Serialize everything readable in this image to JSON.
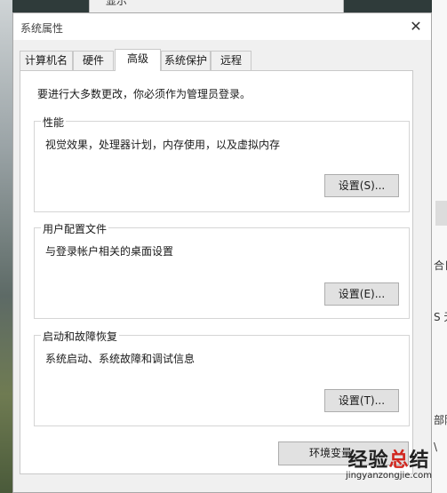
{
  "background": {
    "top_window_peek": "显示",
    "right_fragments": [
      "合日",
      "S 无",
      "部附",
      "\\"
    ]
  },
  "dialog": {
    "title": "系统属性",
    "close_glyph": "✕",
    "tabs": [
      {
        "label": "计算机名",
        "active": false
      },
      {
        "label": "硬件",
        "active": false
      },
      {
        "label": "高级",
        "active": true
      },
      {
        "label": "系统保护",
        "active": false
      },
      {
        "label": "远程",
        "active": false
      }
    ],
    "notice": "要进行大多数更改，你必须作为管理员登录。",
    "groups": [
      {
        "legend": "性能",
        "description": "视觉效果，处理器计划，内存使用，以及虚拟内存",
        "button": "设置(S)..."
      },
      {
        "legend": "用户配置文件",
        "description": "与登录帐户相关的桌面设置",
        "button": "设置(E)..."
      },
      {
        "legend": "启动和故障恢复",
        "description": "系统启动、系统故障和调试信息",
        "button": "设置(T)..."
      }
    ],
    "env_button": "环境变量"
  },
  "watermark": {
    "cn_part1": "经验",
    "cn_part2": "总",
    "cn_part3": "结",
    "en": "jingyanzongjie.com"
  },
  "colors": {
    "dialog_bg": "#f0f0f0",
    "panel_bg": "#ffffff",
    "button_bg": "#e1e1e1",
    "watermark_accent": "#d1261e"
  }
}
